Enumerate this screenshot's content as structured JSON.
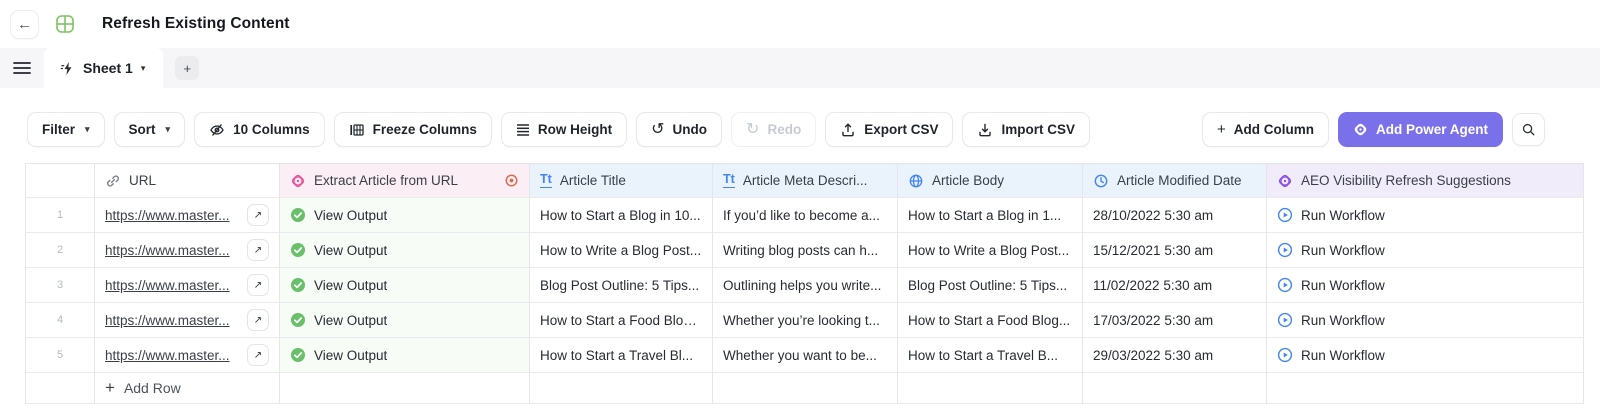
{
  "header": {
    "title": "Refresh Existing Content"
  },
  "tabs": {
    "sheet": "Sheet 1"
  },
  "icons": {
    "plus": "+",
    "caret": "▾",
    "undo": "↺",
    "redo": "↻",
    "external": "↗",
    "back": "←"
  },
  "toolbar": {
    "filter": "Filter",
    "sort": "Sort",
    "columns": "10 Columns",
    "freeze": "Freeze Columns",
    "row_height": "Row Height",
    "undo": "Undo",
    "redo": "Redo",
    "export": "Export CSV",
    "import": "Import CSV",
    "add_column": "Add Column",
    "add_power_agent": "Add Power Agent"
  },
  "colors": {
    "accent_purple": "#7a70ea",
    "pink": "#e8559d",
    "blue": "#4285f4",
    "purple": "#8b52e0",
    "green": "#6abf6a",
    "danger": "#dc6a4f",
    "pink_bg": "#fbeef4",
    "blue_bg": "#eaf2fb",
    "purple_bg": "#f0ecfa"
  },
  "table": {
    "columns": [
      {
        "label": ""
      },
      {
        "label": "URL"
      },
      {
        "label": "Extract Article from URL"
      },
      {
        "label": "Article Title"
      },
      {
        "label": "Article Meta Descri..."
      },
      {
        "label": "Article Body"
      },
      {
        "label": "Article Modified Date"
      },
      {
        "label": "AEO Visibility Refresh Suggestions"
      }
    ],
    "rows": [
      {
        "num": "1",
        "url": "https://www.master...",
        "extract": "View Output",
        "title": "How to Start a Blog in 10...",
        "meta": "If you’d like to become a...",
        "body": "How to Start a Blog in 1...",
        "date": "28/10/2022 5:30 am",
        "aeo": "Run Workflow"
      },
      {
        "num": "2",
        "url": "https://www.master...",
        "extract": "View Output",
        "title": "How to Write a Blog Post...",
        "meta": "Writing blog posts can h...",
        "body": "How to Write a Blog Post...",
        "date": "15/12/2021 5:30 am",
        "aeo": "Run Workflow"
      },
      {
        "num": "3",
        "url": "https://www.master...",
        "extract": "View Output",
        "title": "Blog Post Outline: 5 Tips...",
        "meta": "Outlining helps you write...",
        "body": "Blog Post Outline: 5 Tips...",
        "date": "11/02/2022 5:30 am",
        "aeo": "Run Workflow"
      },
      {
        "num": "4",
        "url": "https://www.master...",
        "extract": "View Output",
        "title": "How to Start a Food Blog...",
        "meta": "Whether you’re looking t...",
        "body": "How to Start a Food Blog...",
        "date": "17/03/2022 5:30 am",
        "aeo": "Run Workflow"
      },
      {
        "num": "5",
        "url": "https://www.master...",
        "extract": "View Output",
        "title": "How to Start a Travel Bl...",
        "meta": "Whether you want to be...",
        "body": "How to Start a Travel B...",
        "date": "29/03/2022 5:30 am",
        "aeo": "Run Workflow"
      }
    ],
    "add_row": "Add Row"
  }
}
